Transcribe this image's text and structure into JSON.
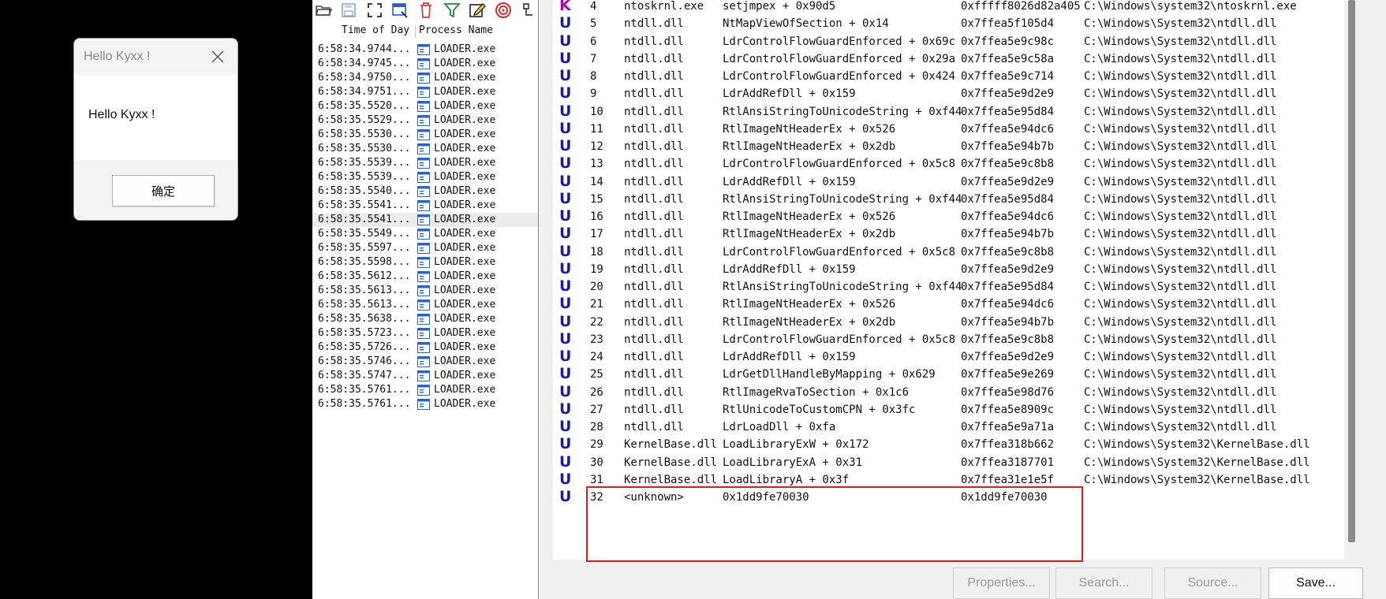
{
  "msgbox": {
    "title": "Hello Kyxx !",
    "message": "Hello Kyxx !",
    "ok_label": "确定"
  },
  "events": {
    "columns": [
      "Time of Day",
      "Process Name"
    ],
    "rows": [
      {
        "time": "6:58:34.9744...",
        "process": "LOADER.exe"
      },
      {
        "time": "6:58:34.9745...",
        "process": "LOADER.exe"
      },
      {
        "time": "6:58:34.9750...",
        "process": "LOADER.exe"
      },
      {
        "time": "6:58:34.9751...",
        "process": "LOADER.exe"
      },
      {
        "time": "6:58:35.5520...",
        "process": "LOADER.exe"
      },
      {
        "time": "6:58:35.5529...",
        "process": "LOADER.exe"
      },
      {
        "time": "6:58:35.5530...",
        "process": "LOADER.exe"
      },
      {
        "time": "6:58:35.5530...",
        "process": "LOADER.exe"
      },
      {
        "time": "6:58:35.5539...",
        "process": "LOADER.exe"
      },
      {
        "time": "6:58:35.5539...",
        "process": "LOADER.exe"
      },
      {
        "time": "6:58:35.5540...",
        "process": "LOADER.exe"
      },
      {
        "time": "6:58:35.5541...",
        "process": "LOADER.exe"
      },
      {
        "time": "6:58:35.5541...",
        "process": "LOADER.exe",
        "selected": true
      },
      {
        "time": "6:58:35.5549...",
        "process": "LOADER.exe"
      },
      {
        "time": "6:58:35.5597...",
        "process": "LOADER.exe"
      },
      {
        "time": "6:58:35.5598...",
        "process": "LOADER.exe"
      },
      {
        "time": "6:58:35.5612...",
        "process": "LOADER.exe"
      },
      {
        "time": "6:58:35.5613...",
        "process": "LOADER.exe"
      },
      {
        "time": "6:58:35.5613...",
        "process": "LOADER.exe"
      },
      {
        "time": "6:58:35.5638...",
        "process": "LOADER.exe"
      },
      {
        "time": "6:58:35.5723...",
        "process": "LOADER.exe"
      },
      {
        "time": "6:58:35.5726...",
        "process": "LOADER.exe"
      },
      {
        "time": "6:58:35.5746...",
        "process": "LOADER.exe"
      },
      {
        "time": "6:58:35.5747...",
        "process": "LOADER.exe"
      },
      {
        "time": "6:58:35.5761...",
        "process": "LOADER.exe"
      },
      {
        "time": "6:58:35.5761...",
        "process": "LOADER.exe"
      }
    ]
  },
  "toolbar_icons": [
    "open-folder-icon",
    "save-icon",
    "autoscroll-icon",
    "capture-icon",
    "clear-icon",
    "filter-icon",
    "highlight-icon",
    "target-icon",
    "process-tree-icon"
  ],
  "stack": {
    "frames": [
      {
        "frame": "K",
        "num": "4",
        "module": "ntoskrnl.exe",
        "location": "setjmpex + 0x90d5",
        "address": "0xfffff8026d82a405",
        "path": "C:\\Windows\\system32\\ntoskrnl.exe"
      },
      {
        "frame": "U",
        "num": "5",
        "module": "ntdll.dll",
        "location": "NtMapViewOfSection + 0x14",
        "address": "0x7ffea5f105d4",
        "path": "C:\\Windows\\System32\\ntdll.dll"
      },
      {
        "frame": "U",
        "num": "6",
        "module": "ntdll.dll",
        "location": "LdrControlFlowGuardEnforced + 0x69c",
        "address": "0x7ffea5e9c98c",
        "path": "C:\\Windows\\System32\\ntdll.dll"
      },
      {
        "frame": "U",
        "num": "7",
        "module": "ntdll.dll",
        "location": "LdrControlFlowGuardEnforced + 0x29a",
        "address": "0x7ffea5e9c58a",
        "path": "C:\\Windows\\System32\\ntdll.dll"
      },
      {
        "frame": "U",
        "num": "8",
        "module": "ntdll.dll",
        "location": "LdrControlFlowGuardEnforced + 0x424",
        "address": "0x7ffea5e9c714",
        "path": "C:\\Windows\\System32\\ntdll.dll"
      },
      {
        "frame": "U",
        "num": "9",
        "module": "ntdll.dll",
        "location": "LdrAddRefDll + 0x159",
        "address": "0x7ffea5e9d2e9",
        "path": "C:\\Windows\\System32\\ntdll.dll"
      },
      {
        "frame": "U",
        "num": "10",
        "module": "ntdll.dll",
        "location": "RtlAnsiStringToUnicodeString + 0xf44",
        "address": "0x7ffea5e95d84",
        "path": "C:\\Windows\\System32\\ntdll.dll"
      },
      {
        "frame": "U",
        "num": "11",
        "module": "ntdll.dll",
        "location": "RtlImageNtHeaderEx + 0x526",
        "address": "0x7ffea5e94dc6",
        "path": "C:\\Windows\\System32\\ntdll.dll"
      },
      {
        "frame": "U",
        "num": "12",
        "module": "ntdll.dll",
        "location": "RtlImageNtHeaderEx + 0x2db",
        "address": "0x7ffea5e94b7b",
        "path": "C:\\Windows\\System32\\ntdll.dll"
      },
      {
        "frame": "U",
        "num": "13",
        "module": "ntdll.dll",
        "location": "LdrControlFlowGuardEnforced + 0x5c8",
        "address": "0x7ffea5e9c8b8",
        "path": "C:\\Windows\\System32\\ntdll.dll"
      },
      {
        "frame": "U",
        "num": "14",
        "module": "ntdll.dll",
        "location": "LdrAddRefDll + 0x159",
        "address": "0x7ffea5e9d2e9",
        "path": "C:\\Windows\\System32\\ntdll.dll"
      },
      {
        "frame": "U",
        "num": "15",
        "module": "ntdll.dll",
        "location": "RtlAnsiStringToUnicodeString + 0xf44",
        "address": "0x7ffea5e95d84",
        "path": "C:\\Windows\\System32\\ntdll.dll"
      },
      {
        "frame": "U",
        "num": "16",
        "module": "ntdll.dll",
        "location": "RtlImageNtHeaderEx + 0x526",
        "address": "0x7ffea5e94dc6",
        "path": "C:\\Windows\\System32\\ntdll.dll"
      },
      {
        "frame": "U",
        "num": "17",
        "module": "ntdll.dll",
        "location": "RtlImageNtHeaderEx + 0x2db",
        "address": "0x7ffea5e94b7b",
        "path": "C:\\Windows\\System32\\ntdll.dll"
      },
      {
        "frame": "U",
        "num": "18",
        "module": "ntdll.dll",
        "location": "LdrControlFlowGuardEnforced + 0x5c8",
        "address": "0x7ffea5e9c8b8",
        "path": "C:\\Windows\\System32\\ntdll.dll"
      },
      {
        "frame": "U",
        "num": "19",
        "module": "ntdll.dll",
        "location": "LdrAddRefDll + 0x159",
        "address": "0x7ffea5e9d2e9",
        "path": "C:\\Windows\\System32\\ntdll.dll"
      },
      {
        "frame": "U",
        "num": "20",
        "module": "ntdll.dll",
        "location": "RtlAnsiStringToUnicodeString + 0xf44",
        "address": "0x7ffea5e95d84",
        "path": "C:\\Windows\\System32\\ntdll.dll"
      },
      {
        "frame": "U",
        "num": "21",
        "module": "ntdll.dll",
        "location": "RtlImageNtHeaderEx + 0x526",
        "address": "0x7ffea5e94dc6",
        "path": "C:\\Windows\\System32\\ntdll.dll"
      },
      {
        "frame": "U",
        "num": "22",
        "module": "ntdll.dll",
        "location": "RtlImageNtHeaderEx + 0x2db",
        "address": "0x7ffea5e94b7b",
        "path": "C:\\Windows\\System32\\ntdll.dll"
      },
      {
        "frame": "U",
        "num": "23",
        "module": "ntdll.dll",
        "location": "LdrControlFlowGuardEnforced + 0x5c8",
        "address": "0x7ffea5e9c8b8",
        "path": "C:\\Windows\\System32\\ntdll.dll"
      },
      {
        "frame": "U",
        "num": "24",
        "module": "ntdll.dll",
        "location": "LdrAddRefDll + 0x159",
        "address": "0x7ffea5e9d2e9",
        "path": "C:\\Windows\\System32\\ntdll.dll"
      },
      {
        "frame": "U",
        "num": "25",
        "module": "ntdll.dll",
        "location": "LdrGetDllHandleByMapping + 0x629",
        "address": "0x7ffea5e9e269",
        "path": "C:\\Windows\\System32\\ntdll.dll"
      },
      {
        "frame": "U",
        "num": "26",
        "module": "ntdll.dll",
        "location": "RtlImageRvaToSection + 0x1c6",
        "address": "0x7ffea5e98d76",
        "path": "C:\\Windows\\System32\\ntdll.dll"
      },
      {
        "frame": "U",
        "num": "27",
        "module": "ntdll.dll",
        "location": "RtlUnicodeToCustomCPN + 0x3fc",
        "address": "0x7ffea5e8909c",
        "path": "C:\\Windows\\System32\\ntdll.dll"
      },
      {
        "frame": "U",
        "num": "28",
        "module": "ntdll.dll",
        "location": "LdrLoadDll + 0xfa",
        "address": "0x7ffea5e9a71a",
        "path": "C:\\Windows\\System32\\ntdll.dll"
      },
      {
        "frame": "U",
        "num": "29",
        "module": "KernelBase.dll",
        "location": "LoadLibraryExW + 0x172",
        "address": "0x7ffea318b662",
        "path": "C:\\Windows\\System32\\KernelBase.dll"
      },
      {
        "frame": "U",
        "num": "30",
        "module": "KernelBase.dll",
        "location": "LoadLibraryExA + 0x31",
        "address": "0x7ffea3187701",
        "path": "C:\\Windows\\System32\\KernelBase.dll"
      },
      {
        "frame": "U",
        "num": "31",
        "module": "KernelBase.dll",
        "location": "LoadLibraryA + 0x3f",
        "address": "0x7ffea31e1e5f",
        "path": "C:\\Windows\\System32\\KernelBase.dll"
      },
      {
        "frame": "U",
        "num": "32",
        "module": "<unknown>",
        "location": "0x1dd9fe70030",
        "address": "0x1dd9fe70030",
        "path": ""
      }
    ]
  },
  "buttons": {
    "properties": "Properties...",
    "search": "Search...",
    "source": "Source...",
    "save": "Save..."
  },
  "colors": {
    "highlight_box": "#e31b1b",
    "user_frame": "#1a1aa8",
    "kernel_frame": "#b000b0"
  }
}
